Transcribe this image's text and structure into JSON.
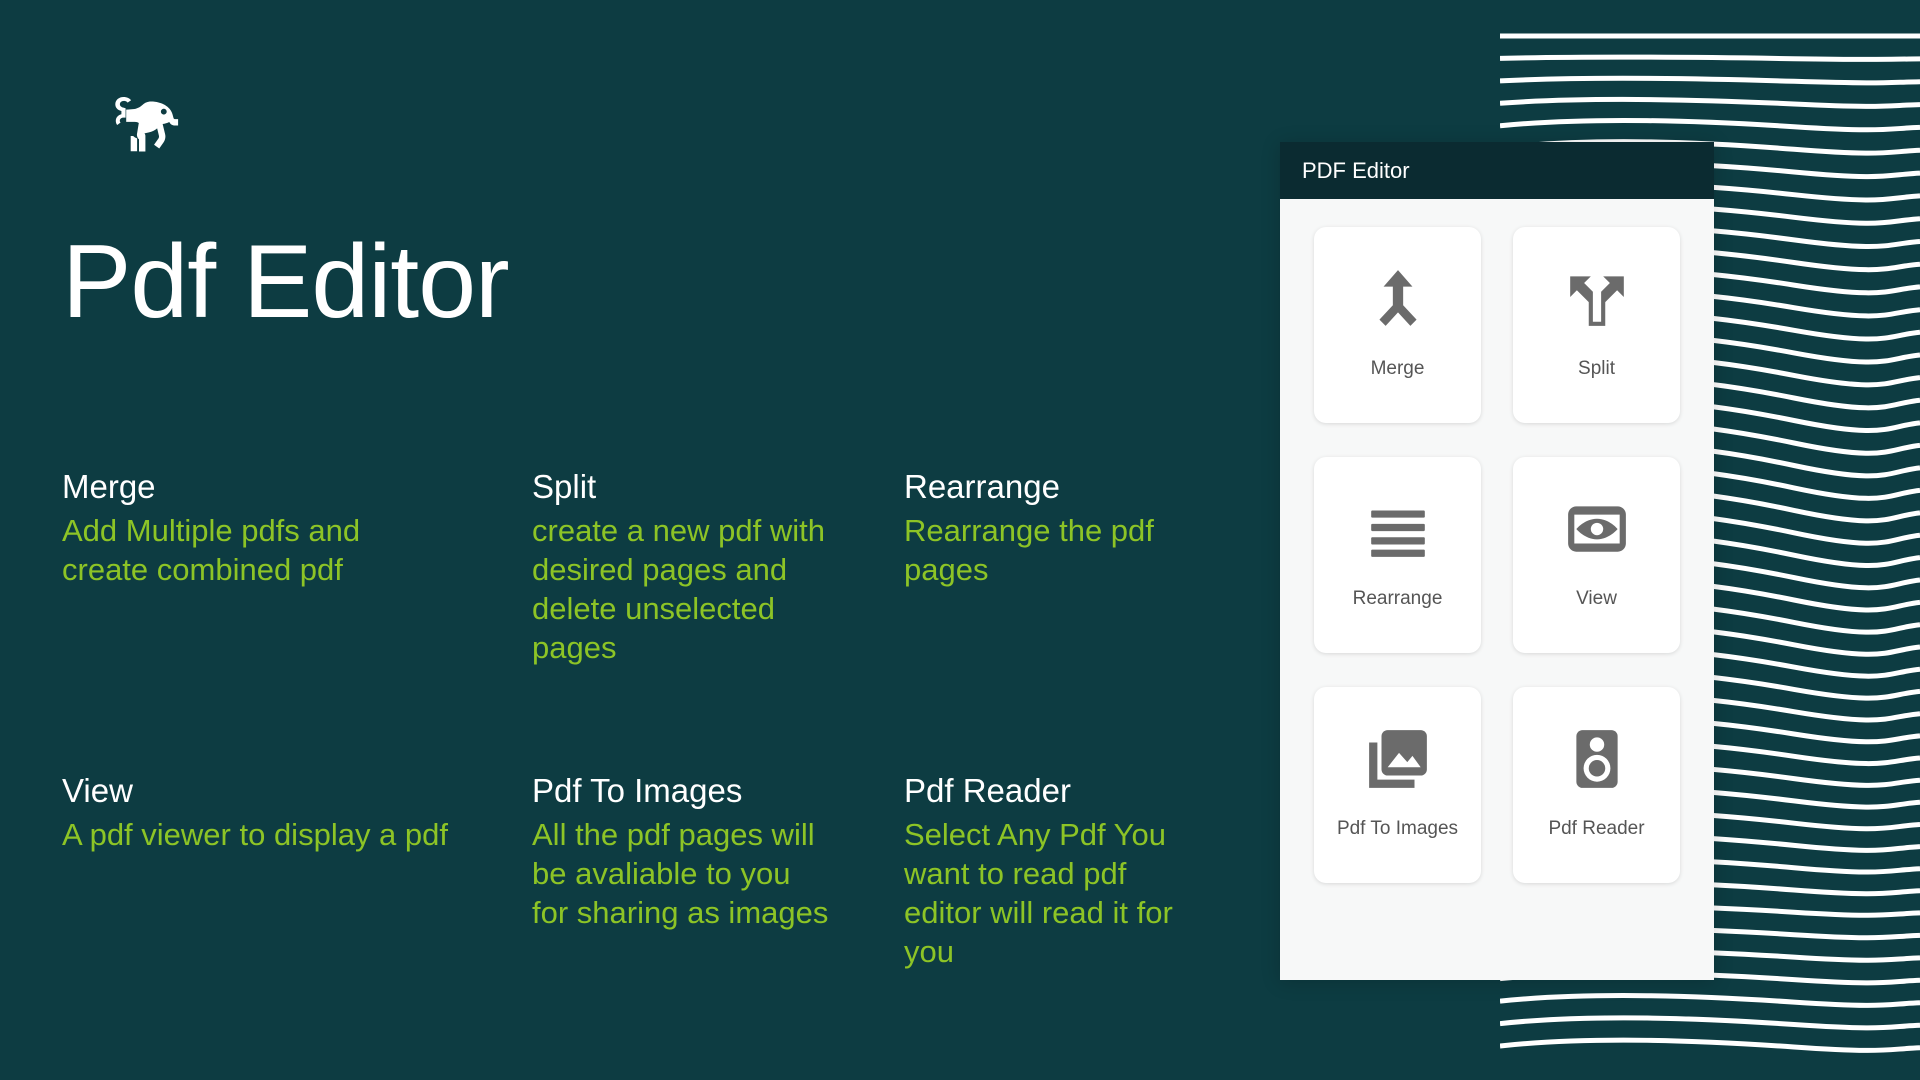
{
  "theme": {
    "background": "#0d3c42",
    "accent_green": "#8dc426",
    "appbar_background": "#0b2b31",
    "card_background": "#ffffff",
    "icon_color": "#6b6b6b",
    "title_color": "#ffffff"
  },
  "brand": {
    "logo_icon": "lion-icon"
  },
  "hero": {
    "title": "Pdf Editor"
  },
  "features": [
    {
      "title": "Merge",
      "description": "Add Multiple pdfs and create combined pdf"
    },
    {
      "title": "Split",
      "description": "create a new pdf with desired pages and delete unselected pages"
    },
    {
      "title": "Rearrange",
      "description": "Rearrange the pdf pages"
    },
    {
      "title": "View",
      "description": "A pdf viewer to display a pdf"
    },
    {
      "title": "Pdf To Images",
      "description": "All the pdf pages will be avaliable to you for sharing as images"
    },
    {
      "title": "Pdf Reader",
      "description": "Select Any Pdf You want to read pdf editor will read it for you"
    }
  ],
  "mockup": {
    "appbar_title": "PDF Editor",
    "cards": [
      {
        "label": "Merge",
        "icon": "merge-arrow-icon"
      },
      {
        "label": "Split",
        "icon": "split-arrow-icon"
      },
      {
        "label": "Rearrange",
        "icon": "reorder-lines-icon"
      },
      {
        "label": "View",
        "icon": "eye-frame-icon"
      },
      {
        "label": "Pdf To Images",
        "icon": "photo-library-icon"
      },
      {
        "label": "Pdf Reader",
        "icon": "speaker-icon"
      }
    ]
  }
}
